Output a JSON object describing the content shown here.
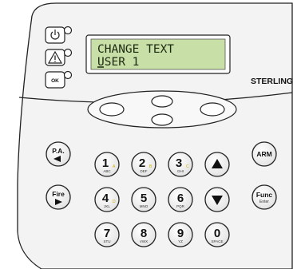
{
  "brand": "STERLING",
  "display": {
    "line1": "CHANGE TEXT",
    "line2": "USER 1"
  },
  "status_icons": [
    {
      "name": "power-icon",
      "led_color": "#ffffff"
    },
    {
      "name": "alert-icon",
      "led_color": "#ffffff"
    },
    {
      "name": "ok-icon",
      "label": "OK",
      "led_color": "#ffffff"
    }
  ],
  "keys": {
    "pa": {
      "label": "P.A."
    },
    "fire": {
      "label": "Fire"
    },
    "arm": {
      "label": "ARM"
    },
    "func": {
      "label": "Func",
      "sub": "Enter"
    },
    "digits": [
      {
        "digit": "1",
        "letter": "A",
        "sub": "ABC"
      },
      {
        "digit": "2",
        "letter": "B",
        "sub": "DEF"
      },
      {
        "digit": "3",
        "letter": "C",
        "sub": "GHI"
      },
      {
        "digit": "4",
        "letter": "D",
        "sub": "JKL"
      },
      {
        "digit": "5",
        "letter": "",
        "sub": "MNO"
      },
      {
        "digit": "6",
        "letter": "",
        "sub": "PQR"
      },
      {
        "digit": "7",
        "letter": "",
        "sub": "STU"
      },
      {
        "digit": "8",
        "letter": "",
        "sub": "VWX"
      },
      {
        "digit": "9",
        "letter": "",
        "sub": "YZ"
      },
      {
        "digit": "0",
        "letter": "",
        "sub": "SPACE"
      }
    ]
  },
  "colors": {
    "body": "#f2f2f2",
    "lcd": "#c9dfa8",
    "letter_accent": "#d4b000"
  }
}
